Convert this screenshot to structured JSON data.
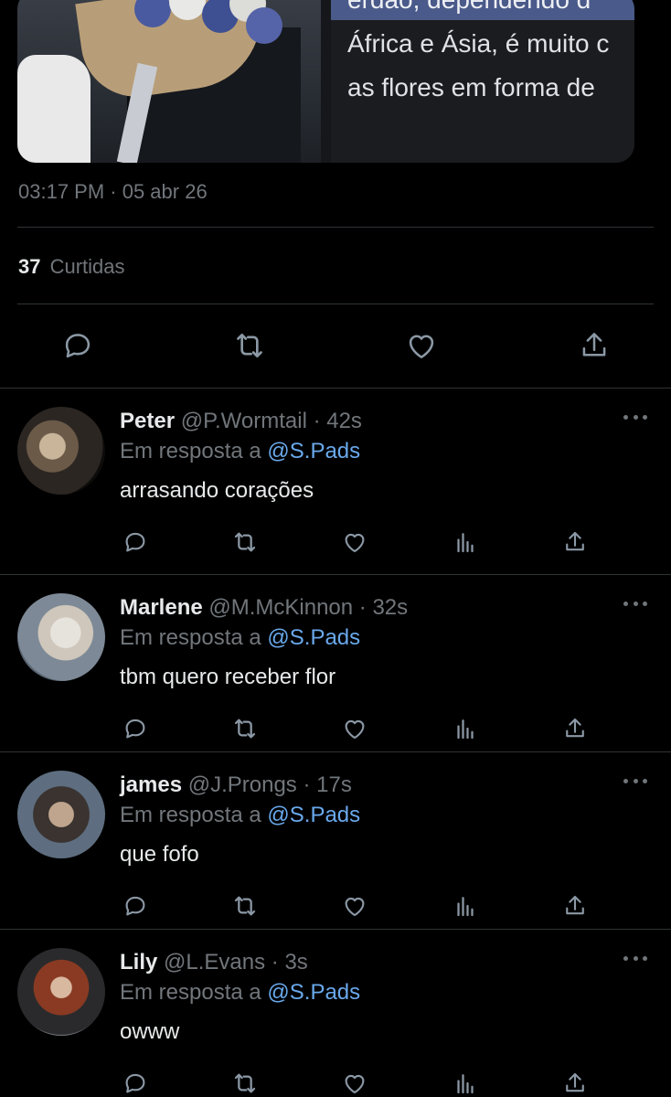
{
  "media": {
    "text_lines": [
      "erdão, dependendo d",
      "África e Ásia, é muito c",
      "as flores em forma de"
    ]
  },
  "tweet": {
    "timestamp": "03:17 PM · 05 abr 26",
    "likes_count": "37",
    "likes_label": "Curtidas"
  },
  "actions": {
    "icons": [
      "reply-icon",
      "retweet-icon",
      "like-icon",
      "share-icon"
    ]
  },
  "replies": [
    {
      "name": "Peter",
      "handle": "@P.Wormtail",
      "time": "· 42s",
      "reply_prefix": "Em resposta a",
      "mention": "@S.Pads",
      "text": "arrasando corações"
    },
    {
      "name": "Marlene",
      "handle": "@M.McKinnon",
      "time": "· 32s",
      "reply_prefix": "Em resposta a",
      "mention": "@S.Pads",
      "text": "tbm quero receber flor"
    },
    {
      "name": "james",
      "handle": "@J.Prongs",
      "time": "· 17s",
      "reply_prefix": "Em resposta a",
      "mention": "@S.Pads",
      "text": "que fofo"
    },
    {
      "name": "Lily",
      "handle": "@L.Evans",
      "time": "· 3s",
      "reply_prefix": "Em resposta a",
      "mention": "@S.Pads",
      "text": "owww"
    }
  ],
  "colors": {
    "background": "#000000",
    "text": "#e7e9ea",
    "muted": "#71767b",
    "link": "#6aa9ec",
    "divider": "#2f3336"
  }
}
